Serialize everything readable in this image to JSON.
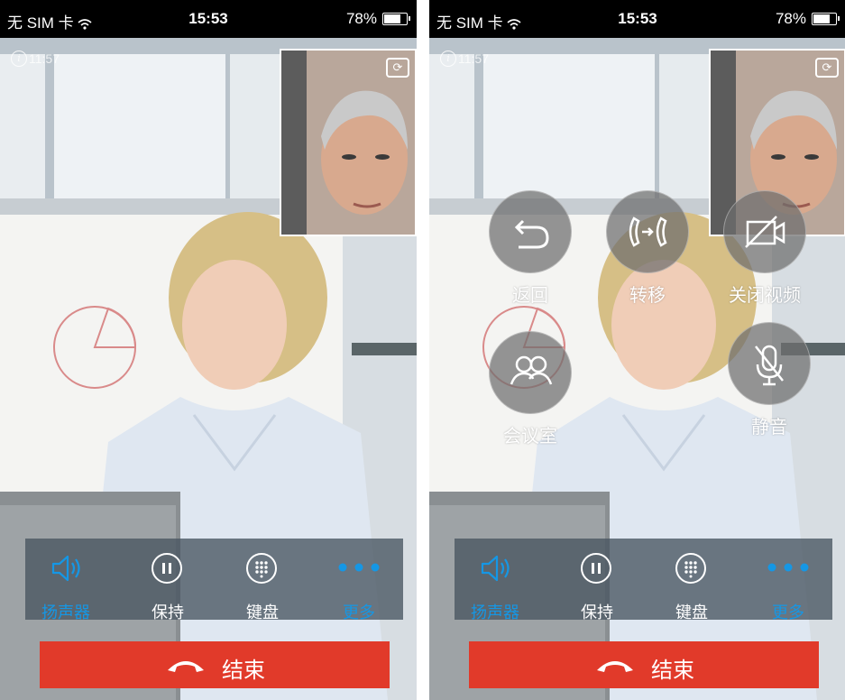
{
  "status_bar": {
    "carrier": "无 SIM 卡",
    "wifi_icon": "wifi-icon",
    "time": "15:53",
    "battery": "78%"
  },
  "call": {
    "duration": "11:57",
    "info_icon": "info-icon"
  },
  "controls": {
    "speaker": {
      "label": "扬声器",
      "icon": "speaker-icon"
    },
    "hold": {
      "label": "保持",
      "icon": "pause-icon"
    },
    "keypad": {
      "label": "键盘",
      "icon": "keypad-icon"
    },
    "more": {
      "label": "更多",
      "icon": "more-dots-icon"
    }
  },
  "end_call": {
    "label": "结束",
    "icon": "hang-up-icon"
  },
  "more_menu": {
    "back": {
      "label": "返回",
      "icon": "back-arrow-icon"
    },
    "transfer": {
      "label": "转移",
      "icon": "transfer-icon"
    },
    "close_video": {
      "label": "关闭视频",
      "icon": "video-off-icon"
    },
    "meeting_room": {
      "label": "会议室",
      "icon": "meeting-room-icon"
    },
    "mute": {
      "label": "静音",
      "icon": "mute-mic-icon"
    }
  },
  "colors": {
    "accent": "#1597e5",
    "end_button": "#e13a2a",
    "control_bar": "#485460"
  }
}
